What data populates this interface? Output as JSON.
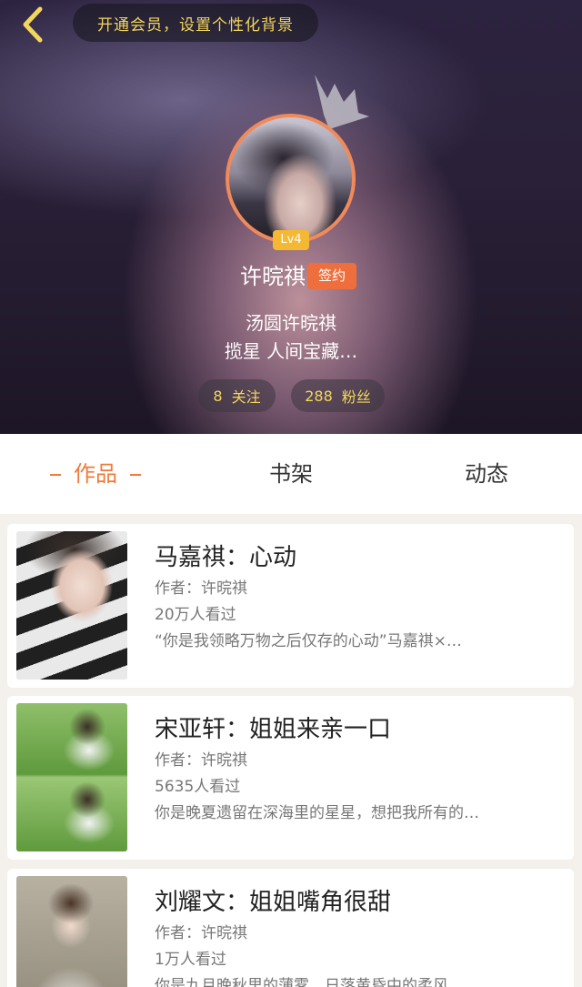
{
  "header": {
    "member_prompt": "开通会员，设置个性化背景",
    "level": "Lv4",
    "username": "许晥祺",
    "sign_badge": "签约",
    "bio_line1": "汤圆许晥祺",
    "bio_line2": "揽星 人间宝藏…",
    "follow_count": "8",
    "follow_label": "关注",
    "fans_count": "288",
    "fans_label": "粉丝"
  },
  "tabs": [
    {
      "label": "作品",
      "active": true
    },
    {
      "label": "书架",
      "active": false
    },
    {
      "label": "动态",
      "active": false
    }
  ],
  "works": [
    {
      "title": "马嘉祺：心动",
      "author": "作者：许晥祺",
      "views": "20万人看过",
      "desc": "“你是我领略万物之后仅存的心动”马嘉祺×…"
    },
    {
      "title": "宋亚轩：姐姐来亲一口",
      "author": "作者：许晥祺",
      "views": "5635人看过",
      "desc": "你是晚夏遗留在深海里的星星，想把我所有的…"
    },
    {
      "title": "刘耀文：姐姐嘴角很甜",
      "author": "作者：许晥祺",
      "views": "1万人看过",
      "desc": "你是九月晚秋里的薄雾，日落黄昏中的柔风…"
    }
  ],
  "colors": {
    "accent": "#f07a3a",
    "avatar_ring": "#f08a5a",
    "gold_text": "#f3d65c",
    "level_badge": "#f5b833",
    "sign_badge": "#ee6f3d"
  }
}
